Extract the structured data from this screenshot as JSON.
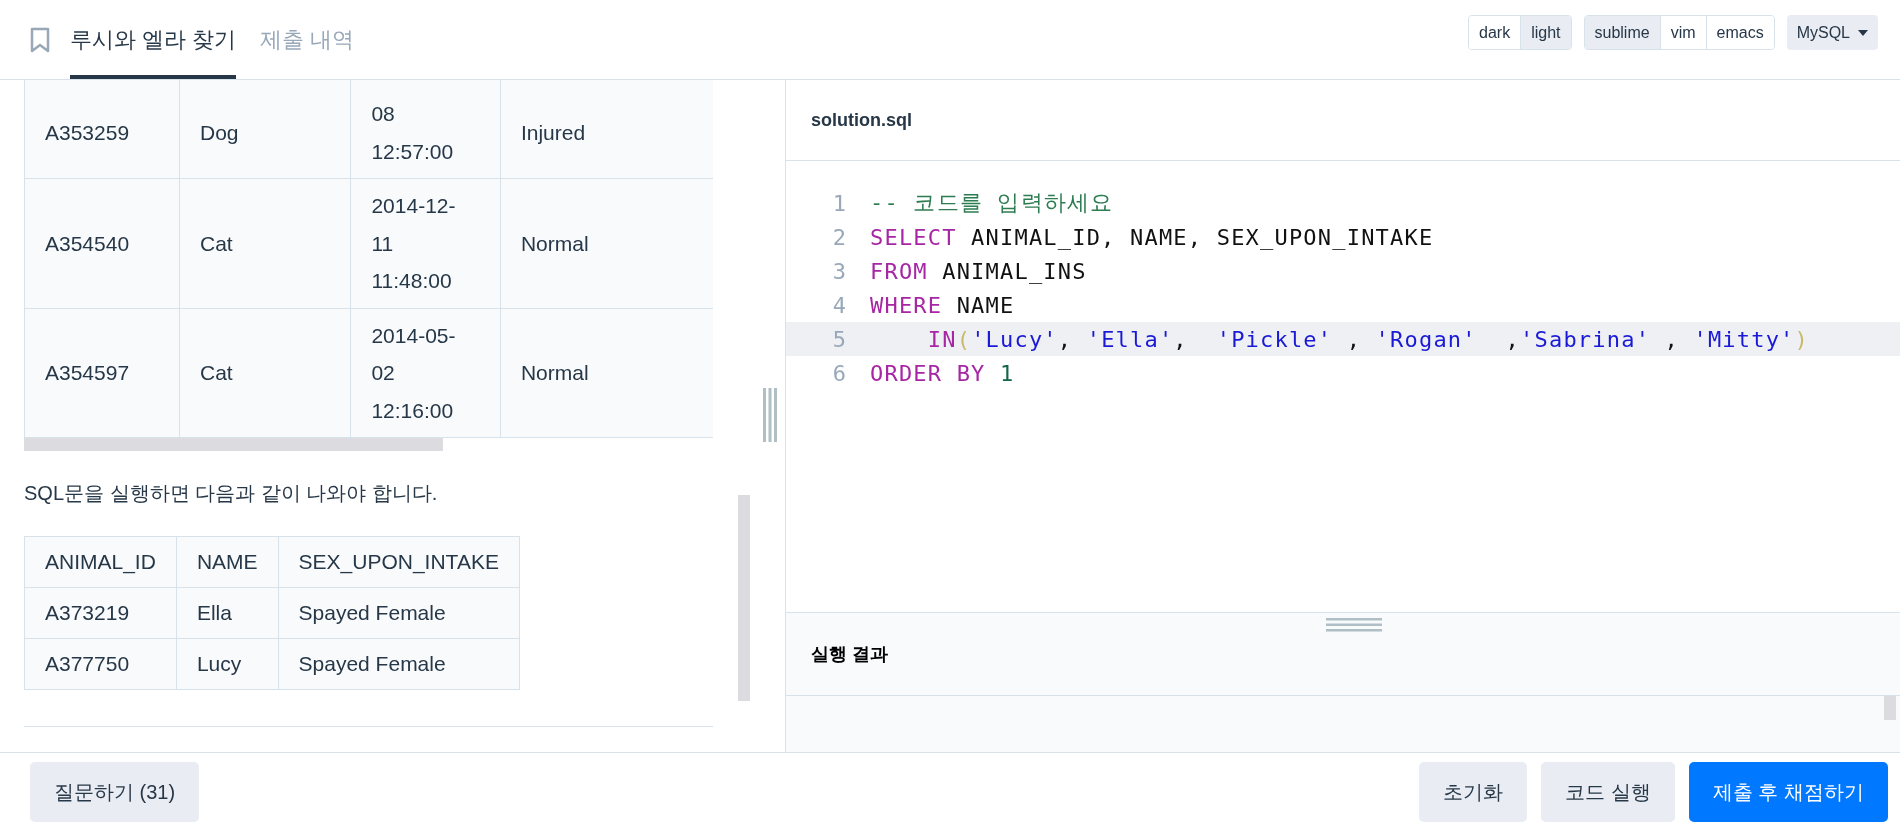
{
  "header": {
    "tabs": [
      {
        "label": "루시와 엘라 찾기",
        "selected": true
      },
      {
        "label": "제출 내역",
        "selected": false
      }
    ],
    "theme_options": [
      {
        "label": "dark",
        "selected": false
      },
      {
        "label": "light",
        "selected": true
      }
    ],
    "keymap_options": [
      {
        "label": "sublime",
        "selected": true
      },
      {
        "label": "vim",
        "selected": false
      },
      {
        "label": "emacs",
        "selected": false
      }
    ],
    "language": "MySQL"
  },
  "problem": {
    "table_rows": [
      {
        "cells": [
          [
            "A353259"
          ],
          [
            "Dog"
          ],
          [
            "08",
            "12:57:00"
          ],
          [
            "Injured"
          ]
        ]
      },
      {
        "cells": [
          [
            "A354540"
          ],
          [
            "Cat"
          ],
          [
            "2014-12-",
            "11",
            "11:48:00"
          ],
          [
            "Normal"
          ]
        ]
      },
      {
        "cells": [
          [
            "A354597"
          ],
          [
            "Cat"
          ],
          [
            "2014-05-",
            "02",
            "12:16:00"
          ],
          [
            "Normal"
          ]
        ]
      }
    ],
    "sentence": "SQL문을 실행하면 다음과 같이 나와야 합니다.",
    "result_table": {
      "columns": [
        "ANIMAL_ID",
        "NAME",
        "SEX_UPON_INTAKE"
      ],
      "rows": [
        [
          "A373219",
          "Ella",
          "Spayed Female"
        ],
        [
          "A377750",
          "Lucy",
          "Spayed Female"
        ]
      ]
    }
  },
  "editor": {
    "file_name": "solution.sql",
    "lines": [
      {
        "number": "1",
        "active": false,
        "tokens": [
          {
            "kind": "comment",
            "text": "-- 코드를 입력하세요"
          }
        ]
      },
      {
        "number": "2",
        "active": false,
        "tokens": [
          {
            "kind": "keyword",
            "text": "SELECT"
          },
          {
            "kind": "plain",
            "text": " ANIMAL_ID, NAME, SEX_UPON_INTAKE"
          }
        ]
      },
      {
        "number": "3",
        "active": false,
        "tokens": [
          {
            "kind": "keyword",
            "text": "FROM"
          },
          {
            "kind": "plain",
            "text": " ANIMAL_INS"
          }
        ]
      },
      {
        "number": "4",
        "active": false,
        "tokens": [
          {
            "kind": "keyword",
            "text": "WHERE"
          },
          {
            "kind": "plain",
            "text": " NAME"
          }
        ]
      },
      {
        "number": "5",
        "active": true,
        "tokens": [
          {
            "kind": "keyword",
            "text": "    IN"
          },
          {
            "kind": "bracket",
            "text": "("
          },
          {
            "kind": "string",
            "text": "'Lucy'"
          },
          {
            "kind": "plain",
            "text": ", "
          },
          {
            "kind": "string",
            "text": "'Ella'"
          },
          {
            "kind": "plain",
            "text": ",  "
          },
          {
            "kind": "string",
            "text": "'Pickle'"
          },
          {
            "kind": "plain",
            "text": " , "
          },
          {
            "kind": "string",
            "text": "'Rogan'"
          },
          {
            "kind": "plain",
            "text": "  ,"
          },
          {
            "kind": "string",
            "text": "'Sabrina'"
          },
          {
            "kind": "plain",
            "text": " , "
          },
          {
            "kind": "string",
            "text": "'Mitty'"
          },
          {
            "kind": "bracket",
            "text": ")"
          }
        ]
      },
      {
        "number": "6",
        "active": false,
        "tokens": [
          {
            "kind": "keyword",
            "text": "ORDER BY"
          },
          {
            "kind": "number",
            "text": " 1"
          }
        ]
      }
    ]
  },
  "result": {
    "title": "실행 결과"
  },
  "footer": {
    "question_button": "질문하기 (31)",
    "buttons": [
      {
        "label": "초기화",
        "kind": "secondary"
      },
      {
        "label": "코드 실행",
        "kind": "secondary"
      },
      {
        "label": "제출 후 채점하기",
        "kind": "primary"
      }
    ]
  }
}
